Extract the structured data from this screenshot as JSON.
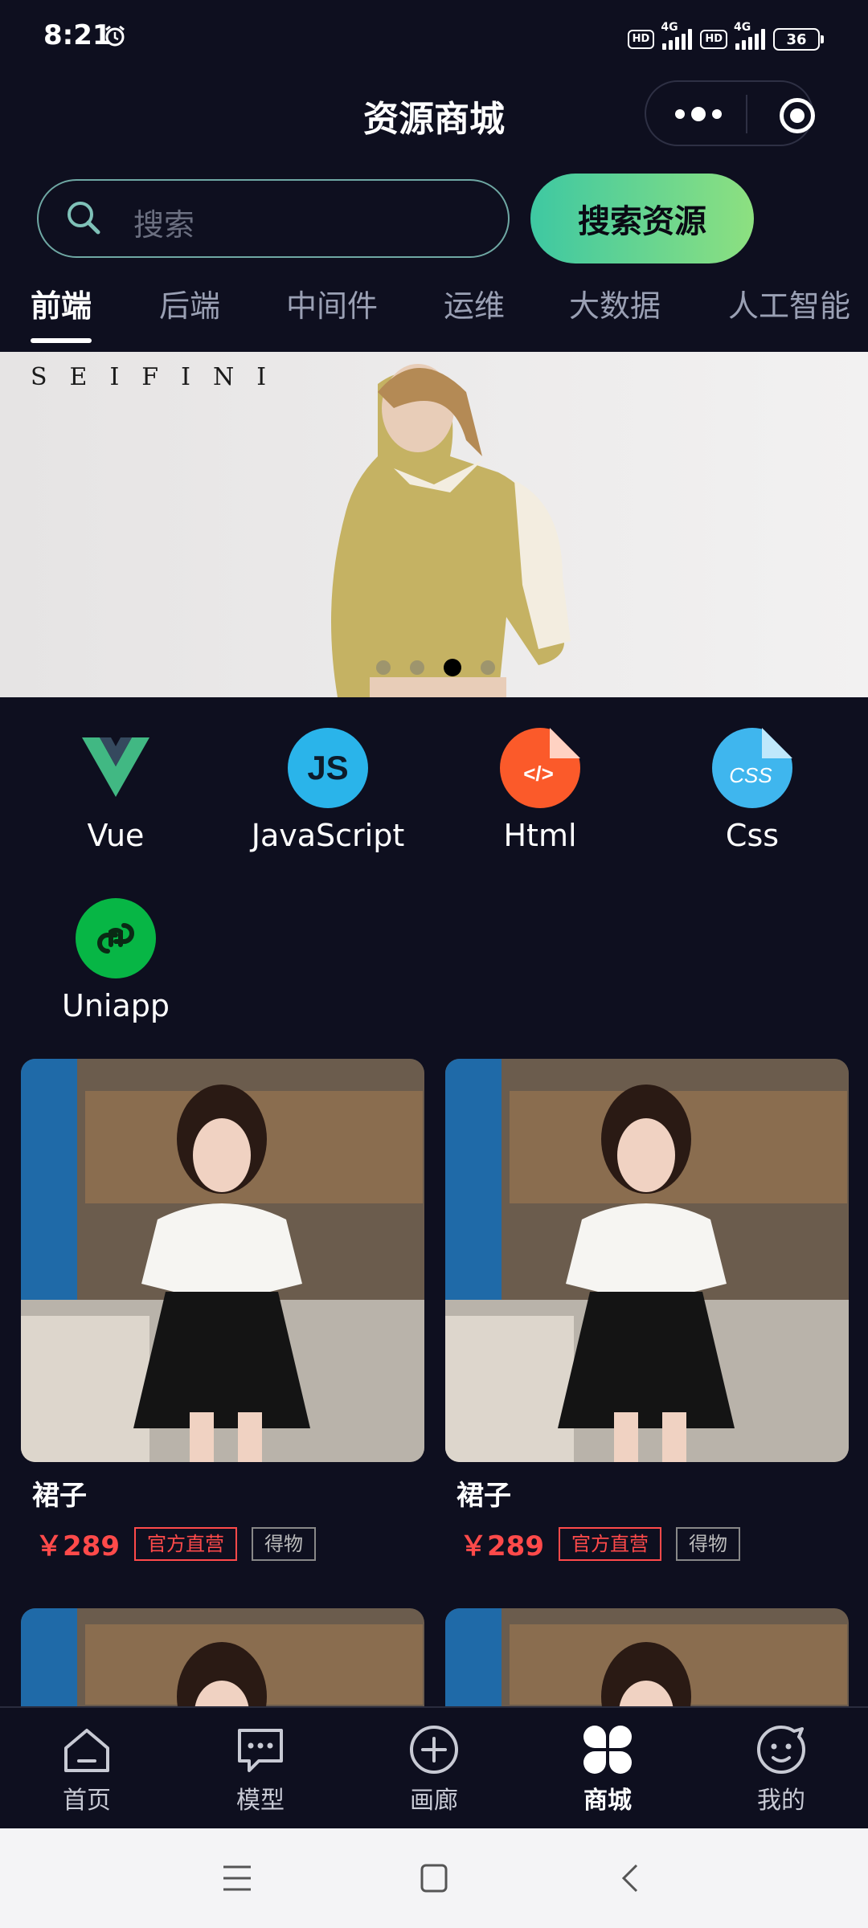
{
  "status_bar": {
    "time": "8:21",
    "network1": "4G",
    "network2": "4G",
    "hd1": "HD",
    "hd2": "HD",
    "battery": "36"
  },
  "header": {
    "title": "资源商城"
  },
  "search": {
    "placeholder": "搜索",
    "button_label": "搜索资源"
  },
  "tabs": [
    {
      "label": "前端",
      "active": true
    },
    {
      "label": "后端"
    },
    {
      "label": "中间件"
    },
    {
      "label": "运维"
    },
    {
      "label": "大数据"
    },
    {
      "label": "人工智能"
    }
  ],
  "banner": {
    "brand_text": "SEIFINI",
    "slide_count": 4,
    "active_slide": 3
  },
  "categories": [
    {
      "label": "Vue",
      "icon": "vue-logo-icon"
    },
    {
      "label": "JavaScript",
      "icon": "javascript-logo-icon",
      "icon_text": "JS"
    },
    {
      "label": "Html",
      "icon": "html-file-icon",
      "icon_text": "</>"
    },
    {
      "label": "Css",
      "icon": "css-file-icon",
      "icon_text": "CSS"
    },
    {
      "label": "Uniapp",
      "icon": "uniapp-logo-icon"
    }
  ],
  "products": [
    {
      "name": "裙子",
      "price": "￥289",
      "badge1": "官方直营",
      "badge2": "得物"
    },
    {
      "name": "裙子",
      "price": "￥289",
      "badge1": "官方直营",
      "badge2": "得物"
    }
  ],
  "bottom_nav": [
    {
      "label": "首页",
      "icon": "home-icon"
    },
    {
      "label": "模型",
      "icon": "chat-bubble-icon"
    },
    {
      "label": "画廊",
      "icon": "plus-circle-icon"
    },
    {
      "label": "商城",
      "icon": "grid-clover-icon",
      "active": true
    },
    {
      "label": "我的",
      "icon": "smiley-icon"
    }
  ],
  "colors": {
    "background": "#0e0f1f",
    "accent_start": "#3ec8a2",
    "accent_end": "#8de080",
    "price": "#ff4a4a"
  }
}
